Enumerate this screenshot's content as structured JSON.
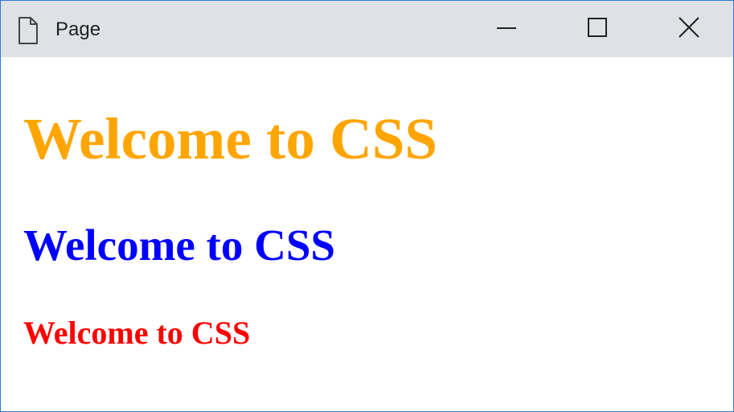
{
  "window": {
    "title": "Page",
    "icons": {
      "page": "page-icon",
      "minimize": "minimize-icon",
      "maximize": "maximize-icon",
      "close": "close-icon"
    }
  },
  "content": {
    "headings": [
      {
        "text": "Welcome to CSS",
        "color": "#ffa500"
      },
      {
        "text": "Welcome to CSS",
        "color": "#0000ff"
      },
      {
        "text": "Welcome to CSS",
        "color": "#ff0000"
      }
    ]
  },
  "colors": {
    "titlebar": "#dee1e6",
    "border": "#2b7bd6"
  }
}
